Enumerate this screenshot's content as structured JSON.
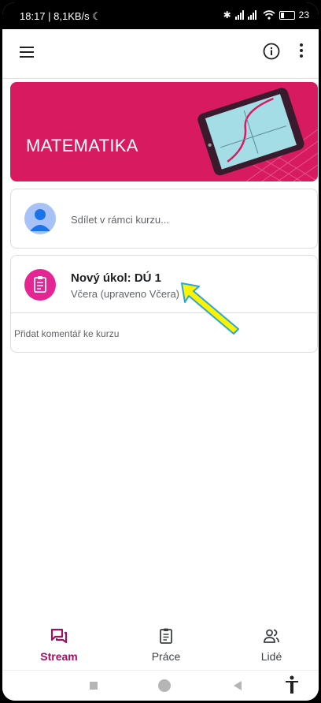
{
  "status": {
    "time_speed": "18:17 | 8,1KB/s",
    "battery": "23"
  },
  "course": {
    "title": "MATEMATIKA"
  },
  "share": {
    "placeholder": "Sdílet v rámci kurzu..."
  },
  "post": {
    "title": "Nový úkol: DÚ 1",
    "subtitle": "Včera (upraveno Včera)",
    "comment_placeholder": "Přidat komentář ke kurzu"
  },
  "bottom_nav": [
    {
      "label": "Stream",
      "active": true
    },
    {
      "label": "Práce",
      "active": false
    },
    {
      "label": "Lidé",
      "active": false
    }
  ],
  "colors": {
    "accent": "#a0105f",
    "banner": "#d81b60",
    "assignment": "#e52592",
    "arrow_fill": "#fff200",
    "arrow_outline": "#2aa7d6"
  },
  "icons": [
    "moon-icon",
    "bluetooth-icon",
    "signal-icon",
    "wifi-icon",
    "battery-icon",
    "menu-icon",
    "info-icon",
    "more-vert-icon",
    "avatar-icon",
    "assignment-icon",
    "stream-icon",
    "classwork-icon",
    "people-icon",
    "recents-icon",
    "home-icon",
    "back-icon",
    "accessibility-icon"
  ]
}
